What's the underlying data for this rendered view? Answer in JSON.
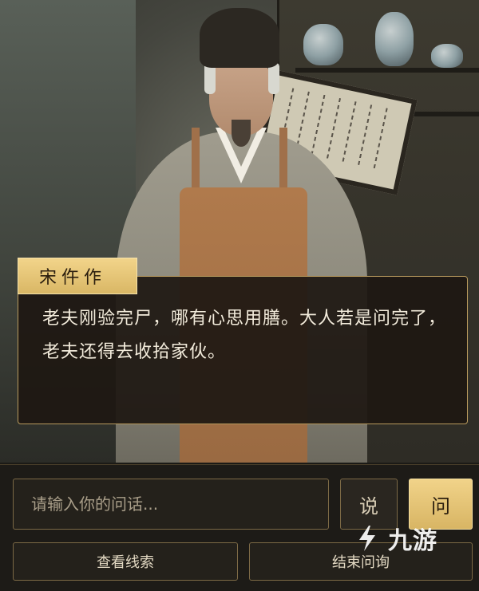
{
  "dialog": {
    "speaker": "宋仵作",
    "text": "老夫刚验完尸，哪有心思用膳。大人若是问完了，老夫还得去收拾家伙。"
  },
  "input": {
    "placeholder": "请输入你的问话..."
  },
  "buttons": {
    "say": "说",
    "ask": "问",
    "view_clues": "查看线索",
    "end_questioning": "结束问询"
  },
  "watermark": {
    "text": "九游"
  },
  "colors": {
    "accent_gold": "#d9b765",
    "border_gold": "#b89a5d",
    "dialog_bg": "#1e1812"
  }
}
